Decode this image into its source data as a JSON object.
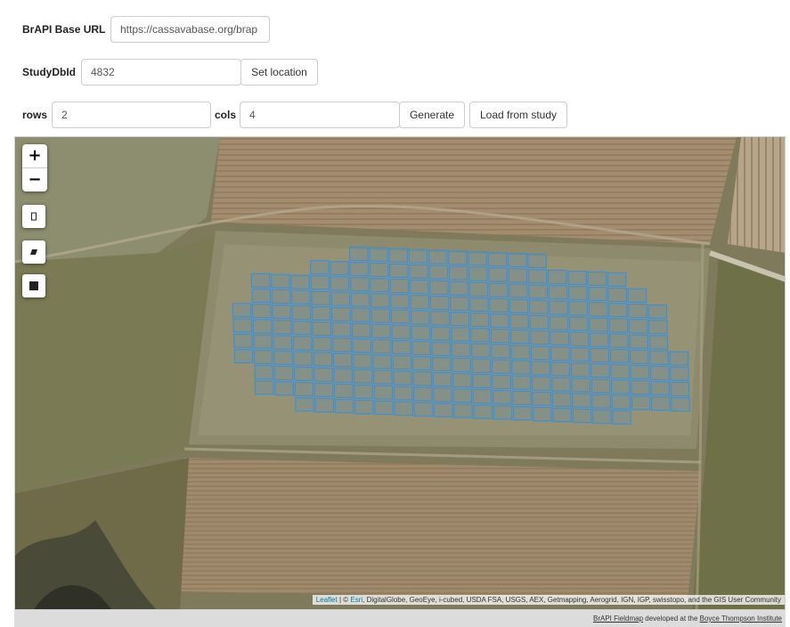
{
  "form": {
    "base_url_label": "BrAPI Base URL",
    "base_url_value": "https://cassavabase.org/brap",
    "study_label": "StudyDbId",
    "study_value": "4832",
    "set_location_label": "Set location",
    "rows_label": "rows",
    "rows_value": "2",
    "cols_label": "cols",
    "cols_value": "4",
    "generate_label": "Generate",
    "load_label": "Load from study"
  },
  "map": {
    "zoom_in": "+",
    "zoom_out": "−",
    "tools": [
      "draw-rectangle-icon",
      "draw-polygon-icon",
      "stop-square-icon"
    ],
    "plot_color": "#3a8fd6",
    "attribution": {
      "leaflet": "Leaflet",
      "sep": " | © ",
      "esri": "Esri",
      "rest": ", DigitalGlobe, GeoEye, i-cubed, USDA FSA, USGS, AEX, Getmapping, Aerogrid, IGN, IGP, swisstopo, and the GIS User Community"
    },
    "footer": {
      "fieldmap": "BrAPI Fieldmap",
      "middle": " developed at the ",
      "bti": "Boyce Thompson Institute"
    }
  }
}
